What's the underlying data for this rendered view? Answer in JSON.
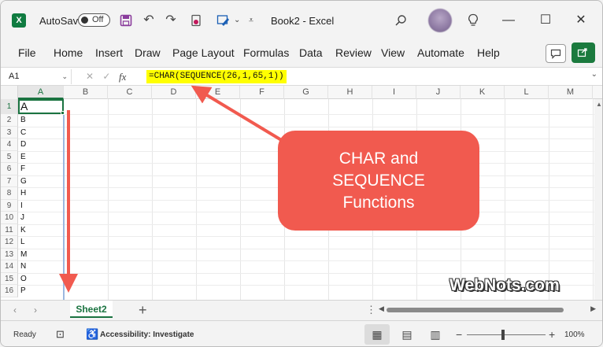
{
  "titlebar": {
    "app_icon": "excel-logo",
    "autosave_label": "AutoSave",
    "autosave_state": "Off",
    "doc_title": "Book2  -  Excel",
    "icons": [
      "save-icon",
      "undo-icon",
      "redo-icon",
      "share-icon",
      "draw-icon",
      "more-icon",
      "search-icon",
      "lightbulb-icon"
    ],
    "window_controls": [
      "minimize",
      "maximize",
      "close"
    ]
  },
  "ribbon": {
    "tabs": [
      "File",
      "Home",
      "Insert",
      "Draw",
      "Page Layout",
      "Formulas",
      "Data",
      "Review",
      "View",
      "Automate",
      "Help"
    ]
  },
  "formula_bar": {
    "name_box": "A1",
    "fx_label": "fx",
    "formula": "=CHAR(SEQUENCE(26,1,65,1))"
  },
  "grid": {
    "columns": [
      "A",
      "B",
      "C",
      "D",
      "E",
      "F",
      "G",
      "H",
      "I",
      "J",
      "K",
      "L",
      "M"
    ],
    "rows": [
      "1",
      "2",
      "3",
      "4",
      "5",
      "6",
      "7",
      "8",
      "9",
      "10",
      "11",
      "12",
      "13",
      "14",
      "15",
      "16"
    ],
    "column_a_values": [
      "A",
      "B",
      "C",
      "D",
      "E",
      "F",
      "G",
      "H",
      "I",
      "J",
      "K",
      "L",
      "M",
      "N",
      "O",
      "P"
    ],
    "selected_column": "A",
    "selected_row": "1"
  },
  "sheets": {
    "active": "Sheet2",
    "add_label": "+"
  },
  "statusbar": {
    "ready": "Ready",
    "accessibility": "Accessibility: Investigate",
    "zoom": "100%"
  },
  "annotation": {
    "callout_line1": "CHAR and",
    "callout_line2": "SEQUENCE",
    "callout_line3": "Functions",
    "watermark": "WebNots.com",
    "color": "#f15a4f"
  }
}
